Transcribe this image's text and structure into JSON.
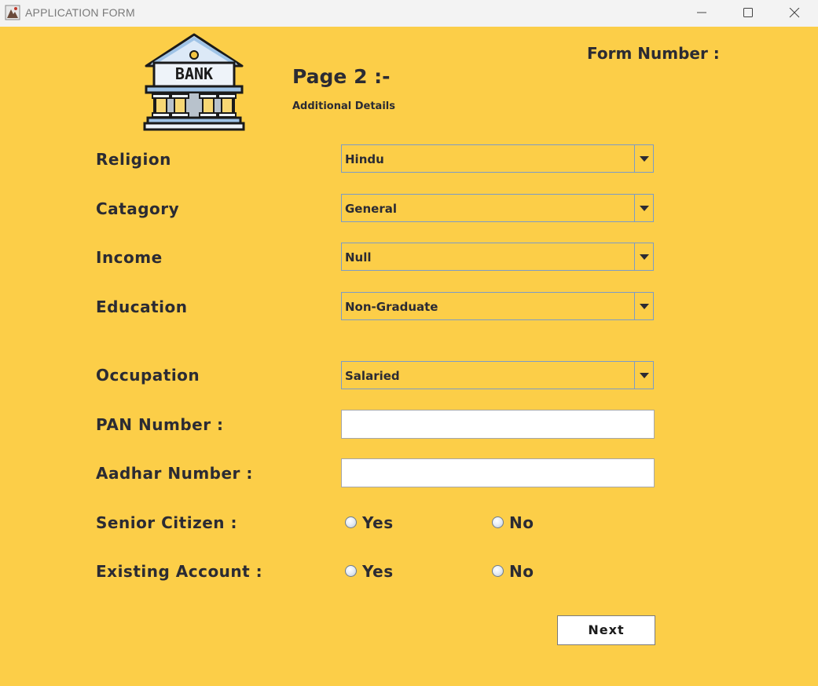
{
  "window": {
    "title": "APPLICATION FORM",
    "icons": [
      "app-icon",
      "minimize-icon",
      "maximize-icon",
      "close-icon"
    ]
  },
  "header": {
    "logo_text": "BANK",
    "page_title": "Page 2 :-",
    "page_subtitle": "Additional Details",
    "form_number_label": "Form Number :"
  },
  "form": {
    "religion": {
      "label": "Religion",
      "value": "Hindu"
    },
    "category": {
      "label": "Catagory",
      "value": "General"
    },
    "income": {
      "label": "Income",
      "value": "Null"
    },
    "education": {
      "label": "Education",
      "value": "Non-Graduate"
    },
    "occupation": {
      "label": "Occupation",
      "value": "Salaried"
    },
    "pan": {
      "label": "PAN Number :",
      "value": ""
    },
    "aadhar": {
      "label": "Aadhar Number :",
      "value": ""
    },
    "senior_citizen": {
      "label": "Senior Citizen :",
      "yes": "Yes",
      "no": "No"
    },
    "existing_account": {
      "label": "Existing Account :",
      "yes": "Yes",
      "no": "No"
    }
  },
  "actions": {
    "next_label": "Next"
  },
  "colors": {
    "background": "#fcce48",
    "titlebar": "#f3f3f3",
    "text": "#2b2b33",
    "combo_border": "#7b9bc7"
  }
}
